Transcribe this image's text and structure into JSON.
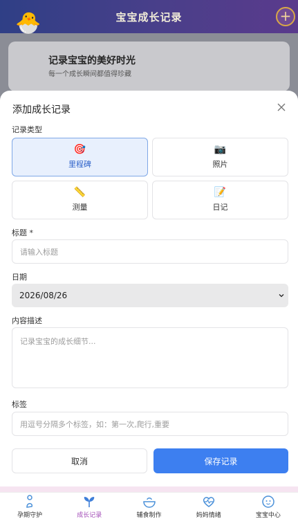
{
  "header": {
    "title": "宝宝成长记录",
    "add_symbol": "+"
  },
  "hero": {
    "title": "记录宝宝的美好时光",
    "subtitle": "每一个成长瞬间都值得珍藏",
    "emoji": "🐣"
  },
  "modal": {
    "title": "添加成长记录",
    "record_type_label": "记录类型",
    "types": [
      {
        "label": "里程碑",
        "icon": "🎯",
        "icon_name": "target-icon",
        "active": true
      },
      {
        "label": "照片",
        "icon": "📷",
        "icon_name": "camera-icon",
        "active": false
      },
      {
        "label": "测量",
        "icon": "📏",
        "icon_name": "ruler-icon",
        "active": false
      },
      {
        "label": "日记",
        "icon": "📝",
        "icon_name": "memo-icon",
        "active": false
      }
    ],
    "title_label": "标题 *",
    "title_placeholder": "请输入标题",
    "date_label": "日期",
    "date_value": "2026/08/26",
    "content_label": "内容描述",
    "content_placeholder": "记录宝宝的成长细节...",
    "tags_label": "标签",
    "tags_placeholder": "用逗号分隔多个标签，如：第一次,爬行,重要",
    "cancel_label": "取消",
    "save_label": "保存记录"
  },
  "bottom_nav": [
    {
      "label": "孕期守护",
      "icon_name": "pregnancy-icon",
      "active": false
    },
    {
      "label": "成长记录",
      "icon_name": "sprout-icon",
      "active": true
    },
    {
      "label": "辅食制作",
      "icon_name": "bowl-icon",
      "active": false
    },
    {
      "label": "妈妈情绪",
      "icon_name": "heart-pulse-icon",
      "active": false
    },
    {
      "label": "宝宝中心",
      "icon_name": "baby-face-icon",
      "active": false
    }
  ],
  "colors": {
    "primary": "#3d7ff0",
    "accent": "#a24bb7",
    "header_start": "#2f3f86",
    "header_end": "#5a3a8c"
  }
}
